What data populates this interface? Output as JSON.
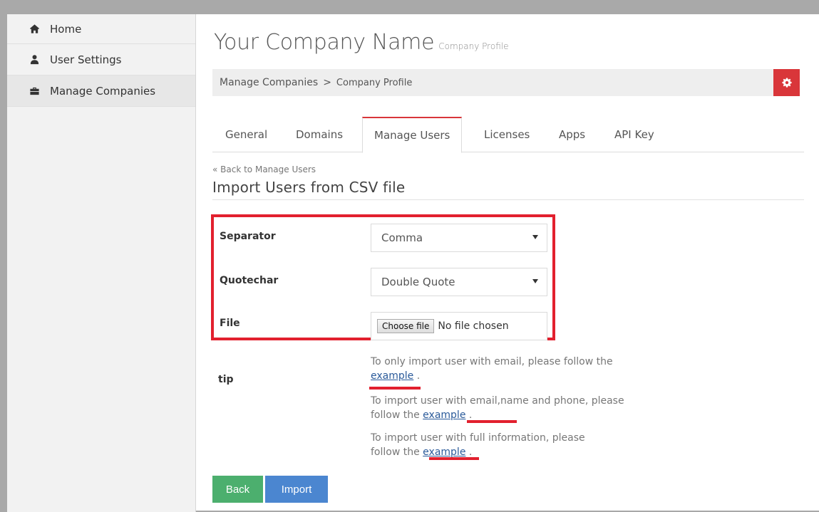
{
  "sidebar": {
    "items": [
      {
        "label": "Home",
        "icon": "home-icon"
      },
      {
        "label": "User Settings",
        "icon": "user-icon"
      },
      {
        "label": "Manage Companies",
        "icon": "briefcase-icon"
      }
    ],
    "active_index": 2
  },
  "header": {
    "title": "Your Company Name",
    "subtitle": "Company Profile"
  },
  "breadcrumb": {
    "parent": "Manage Companies",
    "separator": ">",
    "current": "Company Profile"
  },
  "settings_button": {
    "icon": "gear-icon",
    "color": "#d9363a"
  },
  "tabs": [
    {
      "label": "General"
    },
    {
      "label": "Domains"
    },
    {
      "label": "Manage Users"
    },
    {
      "label": "Licenses"
    },
    {
      "label": "Apps"
    },
    {
      "label": "API Key"
    }
  ],
  "active_tab": "Manage Users",
  "back_link": "« Back to Manage Users",
  "section_title": "Import Users from CSV file",
  "form": {
    "separator_label": "Separator",
    "separator_value": "Comma",
    "quotechar_label": "Quotechar",
    "quotechar_value": "Double Quote",
    "file_label": "File",
    "file_button": "Choose file",
    "file_status": "No file chosen"
  },
  "tip": {
    "label": "tip",
    "line1_text": "To only import user with email, please follow the",
    "line1_link": "example",
    "line2_text": "To import user with email,name and phone, please follow the",
    "line2_link": "example",
    "line3_text": "To import user with full information, please follow the",
    "line3_link": "example"
  },
  "buttons": {
    "back": "Back",
    "import": "Import"
  },
  "colors": {
    "highlight_red": "#e2202e",
    "back_green": "#4caf6e",
    "import_blue": "#4b86d0"
  }
}
